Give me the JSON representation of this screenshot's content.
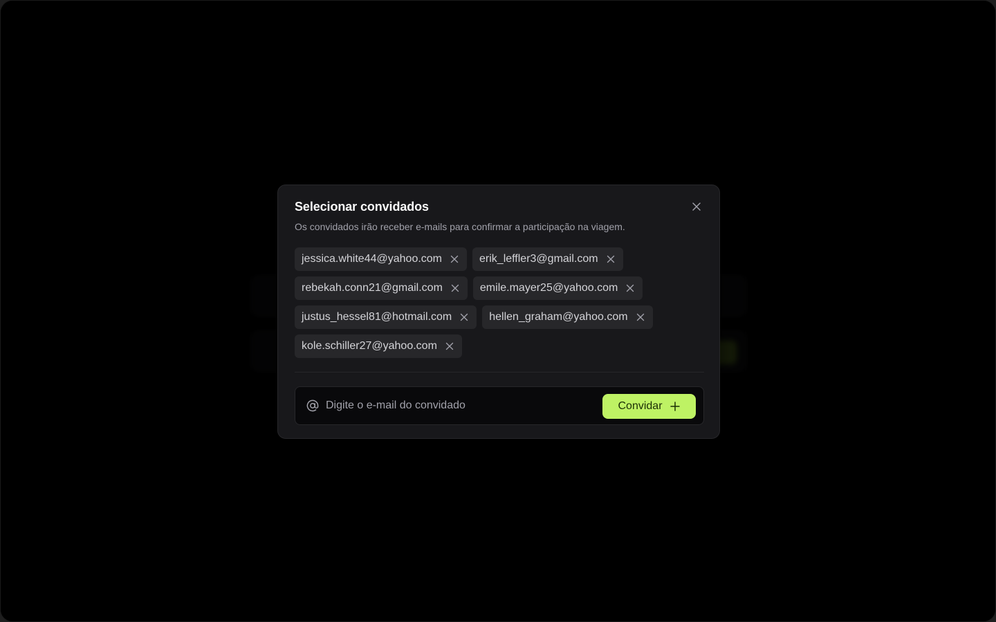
{
  "modal": {
    "title": "Selecionar convidados",
    "description": "Os convidados irão receber e-mails para confirmar a participação na viagem.",
    "close_icon": "close-icon"
  },
  "guests": {
    "rows": [
      [
        "jessica.white44@yahoo.com",
        "erik_leffler3@gmail.com"
      ],
      [
        "rebekah.conn21@gmail.com",
        "emile.mayer25@yahoo.com"
      ],
      [
        "justus_hessel81@hotmail.com",
        "hellen_graham@yahoo.com"
      ],
      [
        "kole.schiller27@yahoo.com"
      ]
    ],
    "remove_icon": "close-icon"
  },
  "invite": {
    "input_icon": "at-sign-icon",
    "placeholder": "Digite o e-mail do convidado",
    "value": "",
    "button_label": "Convidar",
    "button_icon": "plus-icon"
  },
  "colors": {
    "accent": "#bef264",
    "accent_text": "#1a2e05",
    "modal_bg": "#18181b",
    "chip_bg": "#27272a"
  }
}
